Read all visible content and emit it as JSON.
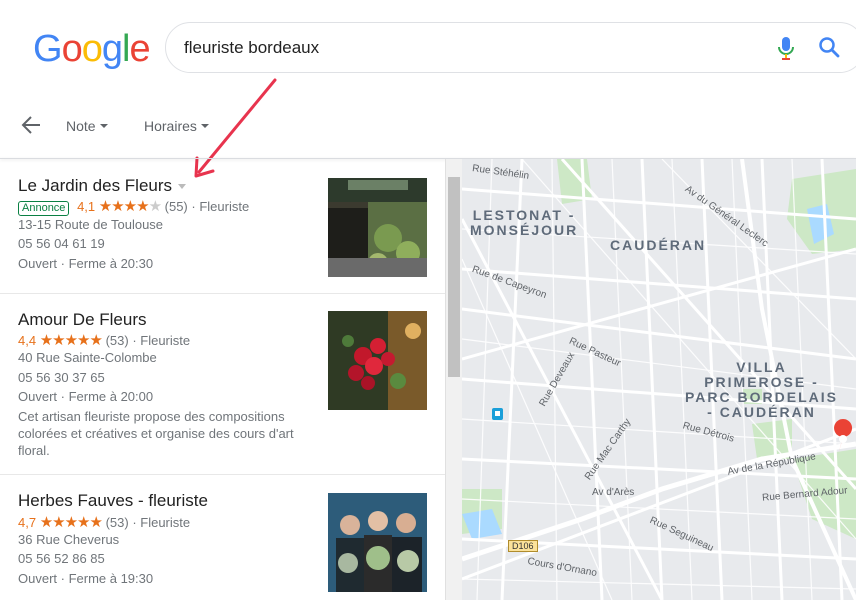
{
  "header": {
    "logo_letters": [
      "G",
      "o",
      "o",
      "g",
      "l",
      "e"
    ],
    "logo_colors": [
      "#4285F4",
      "#EA4335",
      "#FBBC05",
      "#4285F4",
      "#34A853",
      "#EA4335"
    ],
    "query": "fleuriste bordeaux"
  },
  "filters": [
    {
      "label": "Note"
    },
    {
      "label": "Horaires"
    }
  ],
  "results": [
    {
      "name": "Le Jardin des Fleurs",
      "ad_label": "Annonce",
      "rating": "4,1",
      "stars_on": 4,
      "review_count": "(55)",
      "category": "Fleuriste",
      "address": "13-15 Route de Toulouse",
      "phone": "05 56 04 61 19",
      "hours": "Ouvert · Ferme à 20:30"
    },
    {
      "name": "Amour De Fleurs",
      "rating": "4,4",
      "stars_on": 4.5,
      "review_count": "(53)",
      "category": "Fleuriste",
      "address": "40 Rue Sainte-Colombe",
      "phone": "05 56 30 37 65",
      "hours": "Ouvert · Ferme à 20:00",
      "description": "Cet artisan fleuriste propose des compositions colorées et créatives et organise des cours d'art floral."
    },
    {
      "name": "Herbes Fauves - fleuriste",
      "rating": "4,7",
      "stars_on": 4.5,
      "review_count": "(53)",
      "category": "Fleuriste",
      "address": "36 Rue Cheverus",
      "phone": "05 56 52 86 85",
      "hours": "Ouvert · Ferme à 19:30"
    }
  ],
  "map": {
    "districts": {
      "lestonat": "LESTONAT -\nMONSÉJOUR",
      "cauderan": "CAUDÉRAN",
      "villa": "VILLA\nPRIMEROSE -\nPARC BORDELAIS\n- CAUDÉRAN"
    },
    "streets": {
      "stehelin": "Rue Stéhélin",
      "general": "Av du Général Leclerc",
      "capeyron": "Rue de Capeyron",
      "pasteur": "Rue Pasteur",
      "deveaux": "Rue Deveaux",
      "detrois": "Rue Détrois",
      "maccarthy": "Rue Mac Carthy",
      "republique": "Av de la République",
      "ares": "Av d'Arès",
      "bernard": "Rue Bernard Adour",
      "seguineau": "Rue Seguineau",
      "ornano": "Cours d'Ornano"
    },
    "road_badge": "D106",
    "colors": {
      "green": "#c8e6c9",
      "water": "#aadaff",
      "road": "#ffffff",
      "badge": "#fbe29a",
      "pin": "#ea4335"
    }
  }
}
